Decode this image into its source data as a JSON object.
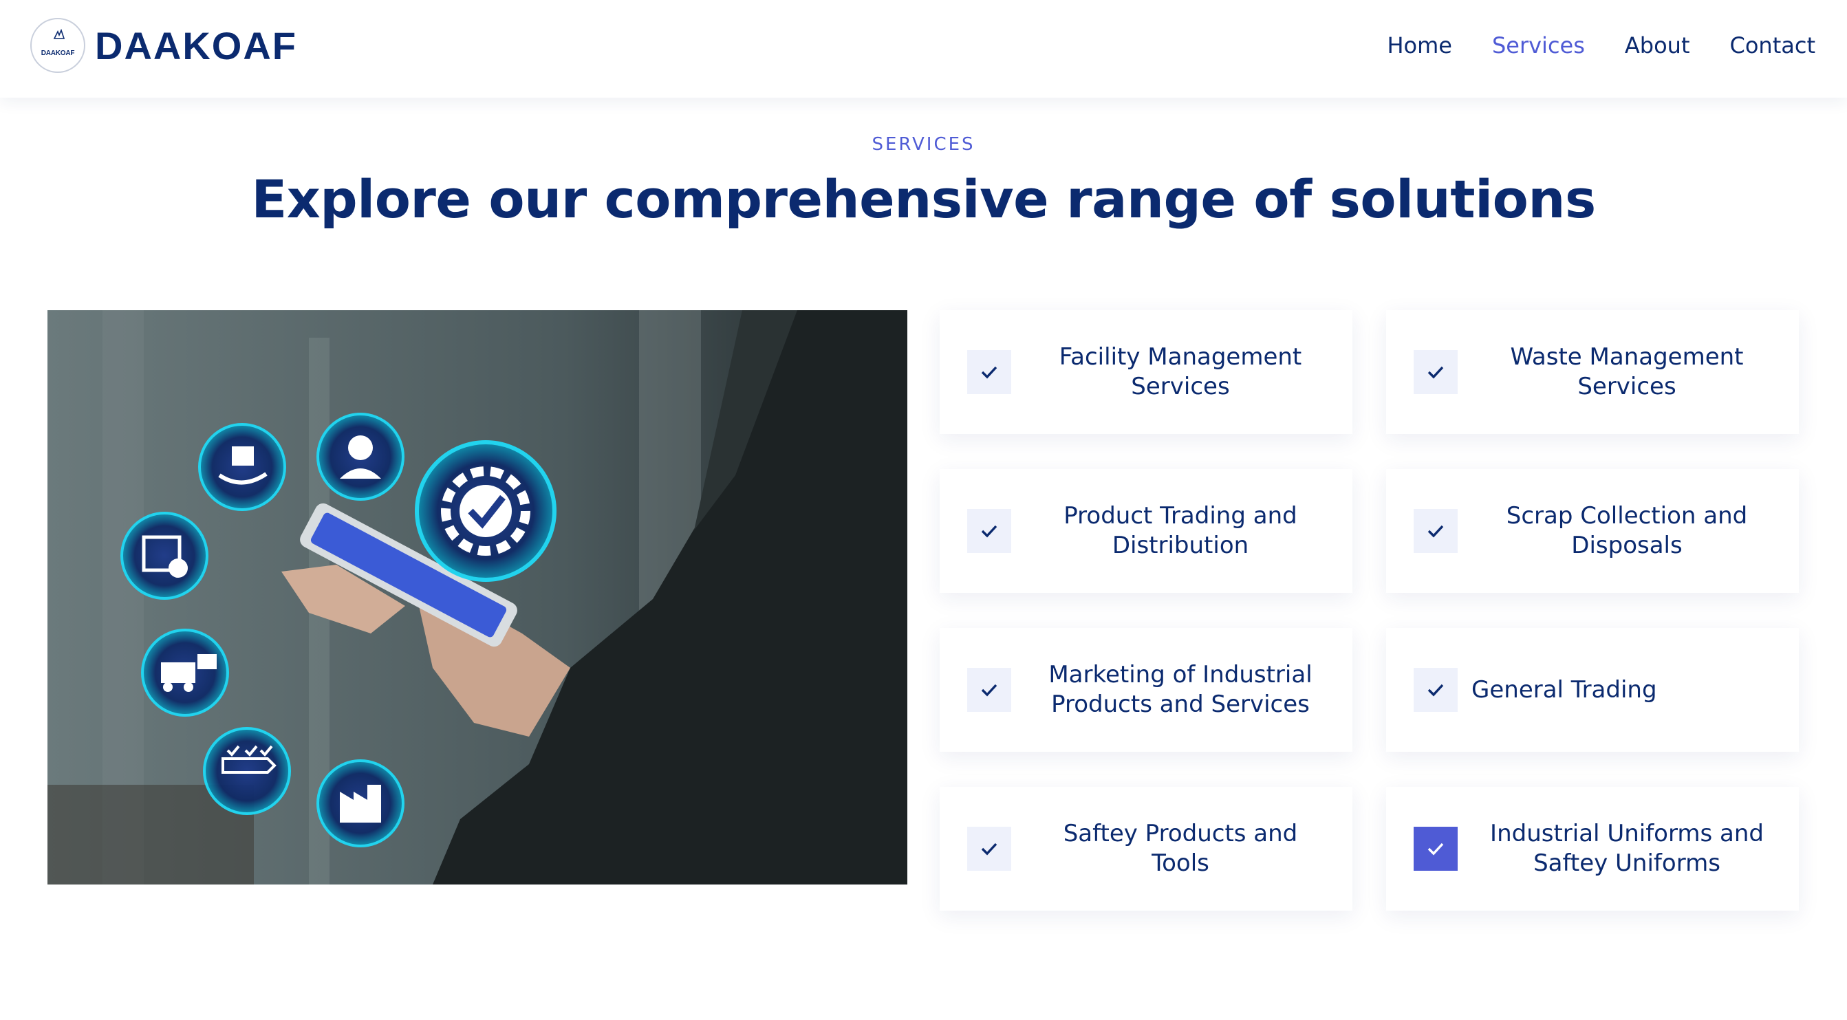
{
  "header": {
    "logo_small_text": "DAAKOAF",
    "brand": "DAAKOAF",
    "nav": [
      {
        "label": "Home",
        "active": false
      },
      {
        "label": "Services",
        "active": true
      },
      {
        "label": "About",
        "active": false
      },
      {
        "label": "Contact",
        "active": false
      }
    ]
  },
  "section": {
    "eyebrow": "SERVICES",
    "title": "Explore our comprehensive range of solutions"
  },
  "colors": {
    "navy": "#0b2a6f",
    "accent": "#4f5bd5",
    "check_bg": "#eef1fb"
  },
  "hero_icons": [
    "hand-box-icon",
    "support-agent-icon",
    "gear-check-icon",
    "box-exchange-icon",
    "forklift-icon",
    "conveyor-icon",
    "factory-icon"
  ],
  "services": [
    {
      "label_lines": [
        "Facility Management",
        "Services"
      ],
      "selected": false
    },
    {
      "label_lines": [
        "Waste Management",
        "Services"
      ],
      "selected": false
    },
    {
      "label_lines": [
        "Product Trading and",
        "Distribution"
      ],
      "selected": false
    },
    {
      "label_lines": [
        "Scrap Collection and",
        "Disposals"
      ],
      "selected": false
    },
    {
      "label_lines": [
        "Marketing of Industrial",
        "Products and Services"
      ],
      "selected": false
    },
    {
      "label_lines": [
        "General Trading"
      ],
      "selected": false
    },
    {
      "label_lines": [
        "Saftey Products and",
        "Tools"
      ],
      "selected": false
    },
    {
      "label_lines": [
        "Industrial Uniforms and",
        "Saftey Uniforms"
      ],
      "selected": true
    }
  ]
}
